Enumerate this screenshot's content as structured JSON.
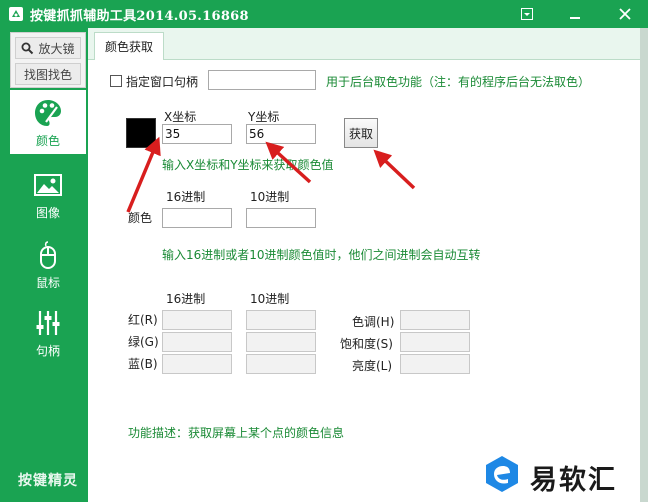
{
  "window": {
    "title": "按键抓抓辅助工具2014.05.16868",
    "controls": {
      "menu": "▣",
      "minimize": "−",
      "close": "✕"
    }
  },
  "sidebar": {
    "top_buttons": {
      "magnifier": "放大镜",
      "find_color": "找图找色"
    },
    "items": [
      {
        "label": "颜色",
        "icon": "palette-icon",
        "active": true
      },
      {
        "label": "图像",
        "icon": "image-icon",
        "active": false
      },
      {
        "label": "鼠标",
        "icon": "mouse-icon",
        "active": false
      },
      {
        "label": "句柄",
        "icon": "sliders-icon",
        "active": false
      }
    ],
    "brand": "按键精灵"
  },
  "tabs": [
    {
      "label": "颜色获取",
      "active": true
    }
  ],
  "form": {
    "window_handle": {
      "checkbox_label": "指定窗口句柄",
      "value": "",
      "hint": "用于后台取色功能（注：有的程序后台无法取色）"
    },
    "coords": {
      "x_label": "X坐标",
      "x_value": "35",
      "y_label": "Y坐标",
      "y_value": "56",
      "get_button": "获取",
      "hint": "输入X坐标和Y坐标来获取颜色值",
      "swatch_color": "#000000"
    },
    "color": {
      "row_label": "颜色",
      "hex_header": "16进制",
      "hex_value": "",
      "dec_header": "10进制",
      "dec_value": "",
      "hint": "输入16进制或者10进制颜色值时，他们之间进制会自动互转"
    },
    "rgb": {
      "hex_header": "16进制",
      "dec_header": "10进制",
      "rows": [
        {
          "label": "红(R)",
          "hex": "",
          "dec": ""
        },
        {
          "label": "绿(G)",
          "hex": "",
          "dec": ""
        },
        {
          "label": "蓝(B)",
          "hex": "",
          "dec": ""
        }
      ]
    },
    "hsl": {
      "rows": [
        {
          "label": "色调(H)",
          "value": ""
        },
        {
          "label": "饱和度(S)",
          "value": ""
        },
        {
          "label": "亮度(L)",
          "value": ""
        }
      ]
    },
    "description": "功能描述：获取屏幕上某个点的颜色信息"
  },
  "watermark": {
    "text": "易软汇"
  },
  "colors": {
    "accent": "#1aa352",
    "hint_green": "#1a8a35",
    "arrow_red": "#d81e1e"
  }
}
